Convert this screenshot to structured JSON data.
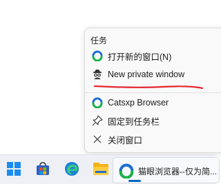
{
  "jumplist": {
    "section_title": "任务",
    "items": [
      {
        "label": "打开新的窗口(N)",
        "icon": "catsxp-icon"
      },
      {
        "label": "New private window",
        "icon": "incognito-icon"
      },
      {
        "label": "Catsxp Browser",
        "icon": "catsxp-icon"
      },
      {
        "label": "固定到任务栏",
        "icon": "pin-icon"
      },
      {
        "label": "关闭窗口",
        "icon": "close-icon"
      }
    ]
  },
  "taskbar": {
    "active_app_label": "猫眼浏览器--仅为简..."
  },
  "colors": {
    "annotation_underline": "#e3262f",
    "catsxp_blue": "#1f6fd1",
    "catsxp_green": "#19b34a",
    "taskbar_indicator": "#0067c0"
  }
}
